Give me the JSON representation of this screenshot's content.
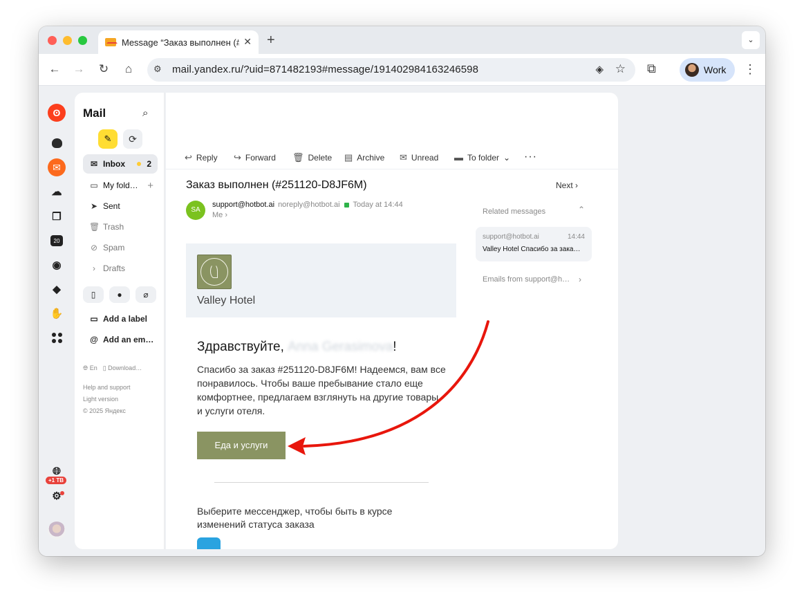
{
  "browser": {
    "tab_title": "Message “Заказ выполнен (#",
    "url": "mail.yandex.ru/?uid=871482193#message/191402984163246598",
    "profile_name": "Work"
  },
  "mail": {
    "app_title": "Mail",
    "folders": [
      {
        "label": "Inbox",
        "count": "2"
      },
      {
        "label": "My fold…"
      },
      {
        "label": "Sent"
      },
      {
        "label": "Trash"
      },
      {
        "label": "Spam"
      },
      {
        "label": "Drafts"
      }
    ],
    "add_label": "Add a label",
    "add_email": "Add an em…",
    "footer": {
      "lang": "En",
      "download": "Download…",
      "help": "Help and support",
      "light": "Light version",
      "copyright": "© 2025 Яндекс"
    },
    "storage_badge": "+1 TB",
    "rail_calendar": "20"
  },
  "message": {
    "actions": {
      "reply": "Reply",
      "forward": "Forward",
      "delete": "Delete",
      "archive": "Archive",
      "unread": "Unread",
      "to_folder": "To folder"
    },
    "subject": "Заказ выполнен (#251120-D8JF6M)",
    "next": "Next",
    "sender_initials": "SA",
    "sender_name": "support@hotbot.ai",
    "sender_email": "noreply@hotbot.ai",
    "time": "Today at 14:44",
    "recipient": "Me",
    "hotel_name": "Valley Hotel",
    "greeting_prefix": "Здравствуйте, ",
    "greeting_name": "Anna Gerasimova",
    "greeting_suffix": "!",
    "body": "Спасибо за заказ #251120-D8JF6M! Надеемся, вам все понравилось. Чтобы ваше пребывание стало еще комфортнее, предлагаем взглянуть на другие товары и услуги отеля.",
    "cta": "Еда и услуги",
    "messenger": "Выберите мессенджер, чтобы быть в курсе изменений статуса заказа"
  },
  "related": {
    "title": "Related messages",
    "item": {
      "from": "support@hotbot.ai",
      "time": "14:44",
      "subject": "Valley Hotel  Спасибо за зака…"
    },
    "emails_from": "Emails from support@h…"
  },
  "colors": {
    "accent_yellow": "#ffdd33",
    "cta_olive": "#8a9462",
    "annotation_red": "#e8160c",
    "sender_green": "#7bc21f"
  }
}
